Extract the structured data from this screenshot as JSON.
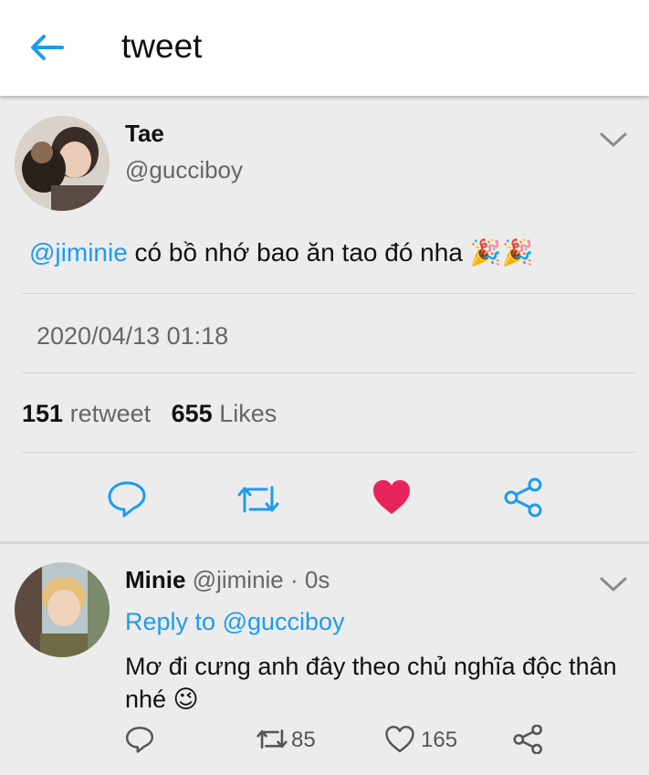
{
  "header": {
    "title": "tweet",
    "back_icon": "arrow-left-icon",
    "accent": "#1d9bf0"
  },
  "tweet": {
    "author_name": "Tae",
    "author_handle": "@gucciboy",
    "mention": "@jiminie",
    "text": " có bồ nhớ bao ăn tao đó nha 🎉🎉",
    "timestamp": "2020/04/13 01:18",
    "retweet_count": "151",
    "retweet_label": "retweet",
    "like_count": "655",
    "like_label": "Likes",
    "liked": true,
    "like_color": "#e8245c",
    "actions": [
      "reply-icon",
      "retweet-icon",
      "heart-icon",
      "share-icon"
    ]
  },
  "reply": {
    "author_name": "Minie",
    "author_handle": "@jiminie",
    "separator": " · ",
    "time": "0s",
    "reply_to_label": "Reply to ",
    "reply_to_handle": "@gucciboy",
    "text": "Mơ đi cưng anh đây theo chủ nghĩa độc thân nhé 😉",
    "retweet_count": "85",
    "like_count": "165",
    "actions": [
      "reply-icon",
      "retweet-icon",
      "heart-outline-icon",
      "share-icon"
    ]
  }
}
